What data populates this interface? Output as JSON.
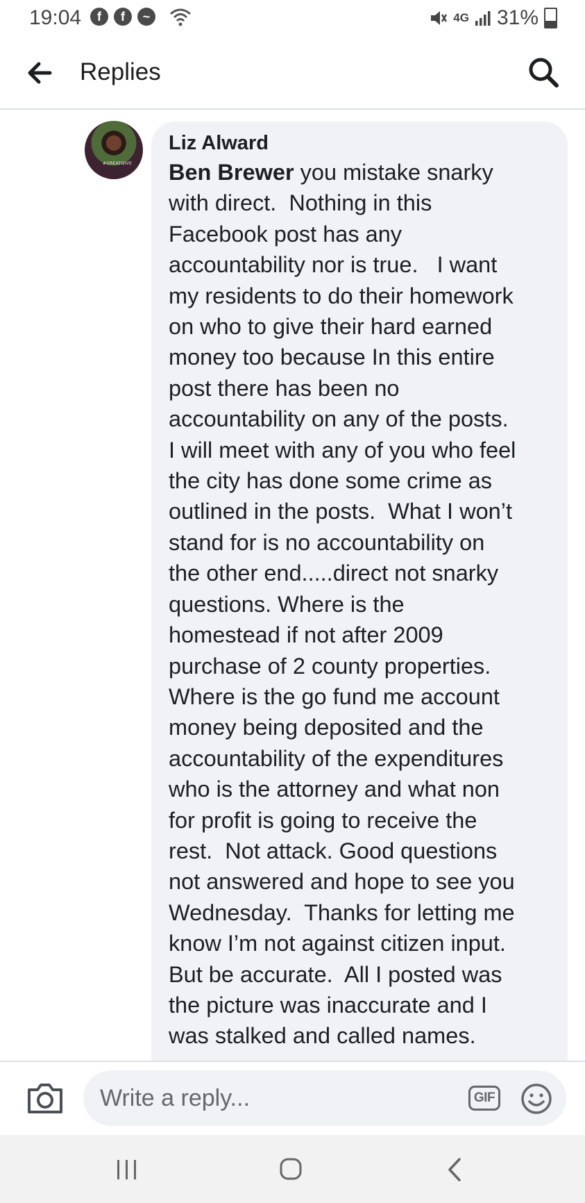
{
  "status_bar": {
    "time": "19:04",
    "notifications": [
      "facebook-icon",
      "facebook-icon",
      "messenger-icon",
      "wifi-icon"
    ],
    "signal": "4G",
    "battery_percent": "31%"
  },
  "header": {
    "title": "Replies",
    "back_icon": "arrow-left-icon",
    "search_icon": "search-icon"
  },
  "comment": {
    "author": "Liz Alward",
    "avatar_badge": "#GREATGIVE",
    "mention": "Ben Brewer",
    "lines": [
      " you mistake snarky",
      "with direct.  Nothing in this",
      "Facebook post has any",
      "accountability nor is true.   I want",
      "my residents to do their homework",
      "on who to give their hard earned",
      "money too because In this entire",
      "post there has been no",
      "accountability on any of the posts.",
      "I will meet with any of you who feel",
      "the city has done some crime as",
      "outlined in the posts.  What I won’t",
      "stand for is no accountability on",
      "the other end.....direct not snarky",
      "questions. Where is the",
      "homestead if not after 2009",
      "purchase of 2 county properties.",
      "Where is the go fund me account",
      "money being deposited and the",
      "accountability of the expenditures",
      "who is the attorney and what non",
      "for profit is going to receive the",
      "rest.  Not attack. Good questions",
      "not answered and hope to see you",
      "Wednesday.  Thanks for letting me",
      "know I’m not against citizen input.",
      "But be accurate.  All I posted was",
      "the picture was inaccurate and I",
      "was stalked and called names."
    ]
  },
  "composer": {
    "placeholder": "Write a reply...",
    "gif_label": "GIF",
    "camera_icon": "camera-icon",
    "emoji_icon": "smiley-icon"
  },
  "android_nav": {
    "recents_icon": "recents-icon",
    "home_icon": "home-icon",
    "back_icon": "chevron-left-icon"
  }
}
